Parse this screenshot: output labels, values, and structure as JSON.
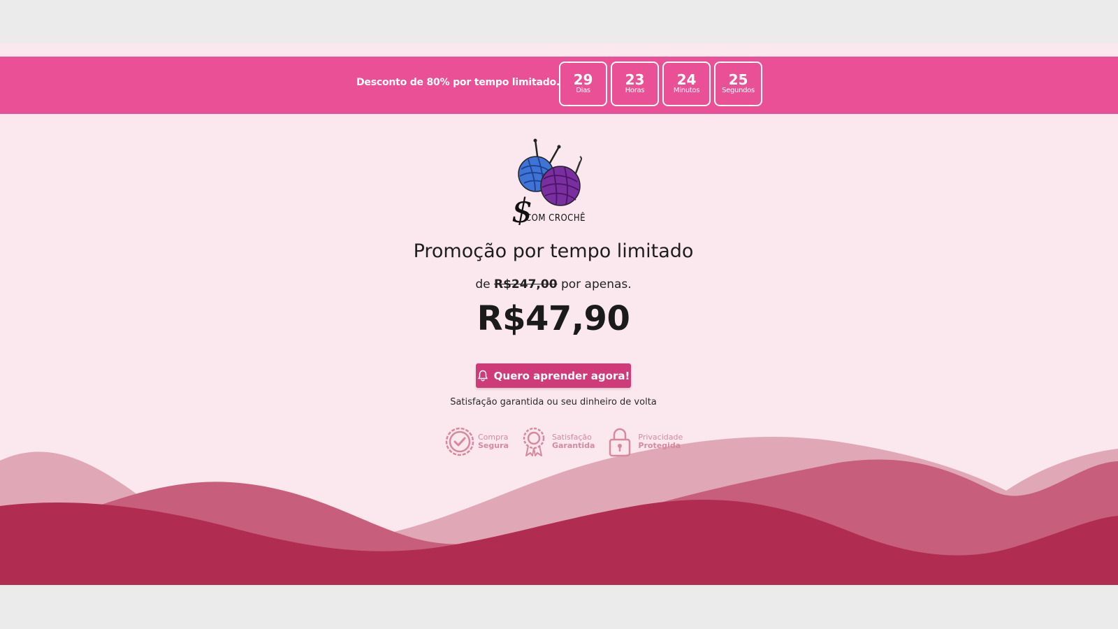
{
  "topbar": {
    "promo_text": "Desconto de 80% por tempo limitado.",
    "countdown": [
      {
        "value": "29",
        "label": "Dias"
      },
      {
        "value": "23",
        "label": "Horas"
      },
      {
        "value": "24",
        "label": "Minutos"
      },
      {
        "value": "25",
        "label": "Segundos"
      }
    ]
  },
  "logo": {
    "text": "$ COM CROCHÊ"
  },
  "main": {
    "headline": "Promoção por tempo limitado",
    "price_prefix": "de",
    "old_price": "R$247,00",
    "price_suffix": "por apenas.",
    "price": "R$47,90",
    "cta_label": "Quero aprender agora!",
    "guarantee": "Satisfação garantida ou seu dinheiro de volta"
  },
  "badges": [
    {
      "line1": "Compra",
      "line2": "Segura",
      "icon": "check-seal-icon"
    },
    {
      "line1": "Satisfação",
      "line2": "Garantida",
      "icon": "award-ribbon-icon"
    },
    {
      "line1": "Privacidade",
      "line2": "Protegida",
      "icon": "lock-icon"
    }
  ],
  "colors": {
    "topbar": "#e95095",
    "background": "#fbe8ee",
    "button": "#cf3a79",
    "wave_dark": "#b02d51",
    "wave_mid": "#c75f7c",
    "wave_light": "#e0a8b6"
  }
}
